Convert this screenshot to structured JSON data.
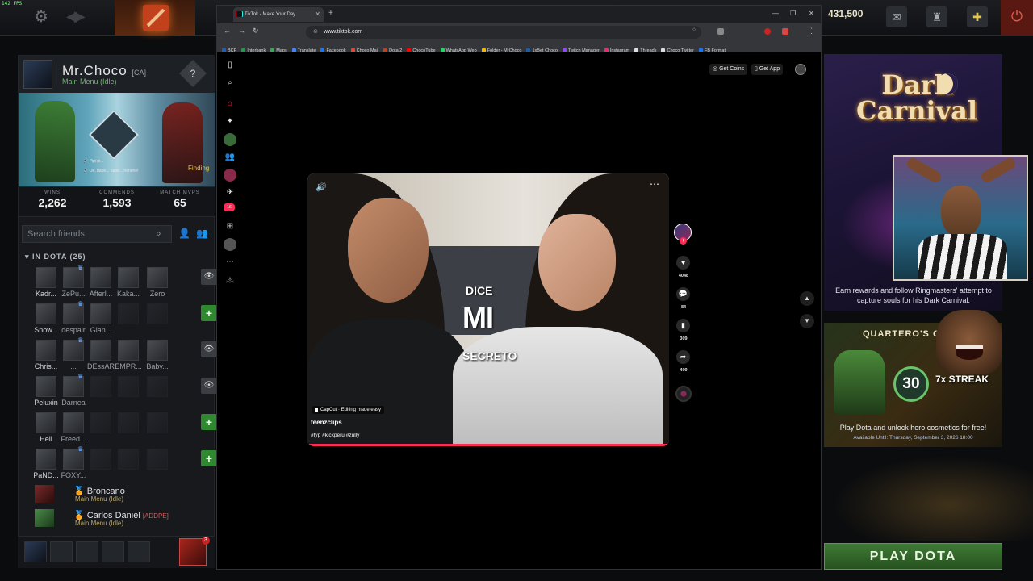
{
  "dota": {
    "fps": "142 FPS",
    "currency": "431,500",
    "profile": {
      "name": "Mr.Choco",
      "tag": "[CA]",
      "status": "Main Menu (Idle)",
      "voice_line_1": "Pipi pi...",
      "voice_line_2": "Oe, babe... babe... hehehe!",
      "stats": [
        {
          "label": "WINS",
          "value": "2,262"
        },
        {
          "label": "COMMENDS",
          "value": "1,593"
        },
        {
          "label": "MATCH MVPS",
          "value": "65"
        }
      ]
    },
    "search_placeholder": "Search friends",
    "group": "IN DOTA (25)",
    "friend_grid": [
      {
        "names": [
          "Kadr...",
          "ZePu...",
          "Afterl...",
          "Kaka...",
          "Zero"
        ],
        "crowns": [
          false,
          true,
          false,
          false,
          false
        ],
        "action": "eye"
      },
      {
        "names": [
          "Snow...",
          "despair",
          "Gian...",
          "",
          ""
        ],
        "crowns": [
          false,
          true,
          false,
          false,
          false
        ],
        "action": "plus"
      },
      {
        "names": [
          "Chris...",
          "...",
          "DEssAR",
          "EMPR...",
          "Baby..."
        ],
        "crowns": [
          false,
          true,
          false,
          false,
          false
        ],
        "action": "eye"
      },
      {
        "names": [
          "Peluxin",
          "Darnea",
          "",
          "",
          ""
        ],
        "crowns": [
          false,
          true,
          false,
          false,
          false
        ],
        "action": "eye"
      },
      {
        "names": [
          "Hell",
          "Freed...",
          "",
          "",
          ""
        ],
        "crowns": [
          false,
          false,
          false,
          false,
          false
        ],
        "action": "plus"
      },
      {
        "names": [
          "PaND...",
          "FOXY...",
          "",
          "",
          ""
        ],
        "crowns": [
          false,
          true,
          false,
          false,
          false
        ],
        "action": "plus"
      }
    ],
    "finding": "Finding",
    "friends_list": [
      {
        "name": "Broncano",
        "tag": "",
        "status": "Main Menu (Idle)"
      },
      {
        "name": "Carlos Daniel",
        "tag": "[ADDPE]",
        "status": "Main Menu (Idle)"
      }
    ],
    "dock_badge": "3",
    "promo1": {
      "title_line1": "Dark",
      "title_line2": "Carnival",
      "text": "Earn rewards and follow Ringmasters' attempt to capture souls for his Dark Carnival."
    },
    "promo2": {
      "title": "QUARTERO'S C",
      "number": "30",
      "streak": "7x STREAK",
      "text": "Play Dota and unlock hero cosmetics for free!",
      "available": "Available Until:  Thursday, September 3, 2026 18:00"
    },
    "play_button": "PLAY DOTA"
  },
  "browser": {
    "tab_title": "TikTok - Make Your Day",
    "url": "www.tiktok.com",
    "bookmarks": [
      {
        "label": "BCP",
        "color": "#1f5fbf"
      },
      {
        "label": "Interbank",
        "color": "#1a9a4a"
      },
      {
        "label": "Maps",
        "color": "#34a853"
      },
      {
        "label": "Translate",
        "color": "#4285f4"
      },
      {
        "label": "Facebook",
        "color": "#1877f2"
      },
      {
        "label": "Choco Mail",
        "color": "#ea4335"
      },
      {
        "label": "Dota 2",
        "color": "#c0411b"
      },
      {
        "label": "ChocoTube",
        "color": "#ff0000"
      },
      {
        "label": "WhatsApp Web",
        "color": "#25d366"
      },
      {
        "label": "Folder - MrChoco",
        "color": "#f4b400"
      },
      {
        "label": "1xBet Choco",
        "color": "#1a5fa8"
      },
      {
        "label": "Twitch Manager",
        "color": "#9146ff"
      },
      {
        "label": "Instagram",
        "color": "#e1306c"
      },
      {
        "label": "Threads",
        "color": "#dddddd"
      },
      {
        "label": "Choco Twitter",
        "color": "#dddddd"
      },
      {
        "label": "FB Format",
        "color": "#1877f2"
      }
    ],
    "tiktok": {
      "get_coins": "Get Coins",
      "get_app": "Get App",
      "inbox_badge": "16",
      "video": {
        "caption_1": "DICE",
        "caption_2": "MI",
        "caption_3": "SECRETO",
        "badge": "CapCut · Editing made easy",
        "username": "feenzclips",
        "tags": "#fyp #kickperu #zully"
      },
      "actions": {
        "likes": "4048",
        "comments": "84",
        "saves": "309",
        "shares": "409"
      }
    }
  }
}
